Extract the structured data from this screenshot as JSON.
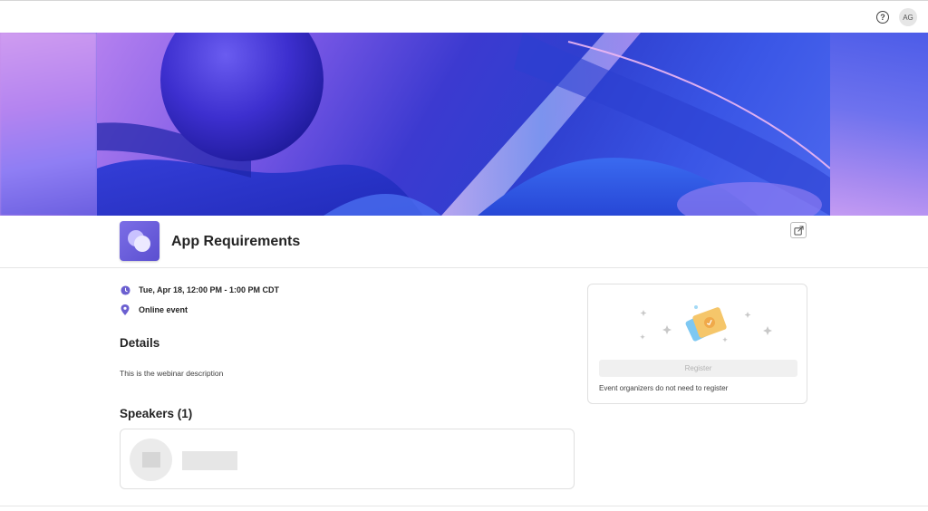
{
  "topbar": {
    "help_icon": "question-circle-icon",
    "help_glyph": "?",
    "user_initials": "AG"
  },
  "event": {
    "title": "App Requirements",
    "datetime": "Tue, Apr 18, 12:00 PM - 1:00 PM CDT",
    "location": "Online event",
    "details_heading": "Details",
    "description": "This is the webinar description",
    "speakers_heading": "Speakers (1)"
  },
  "registration": {
    "button_label": "Register",
    "note": "Event organizers do not need to register"
  },
  "colors": {
    "accent": "#5b5fc7",
    "icon_purple": "#6b5fd0"
  }
}
